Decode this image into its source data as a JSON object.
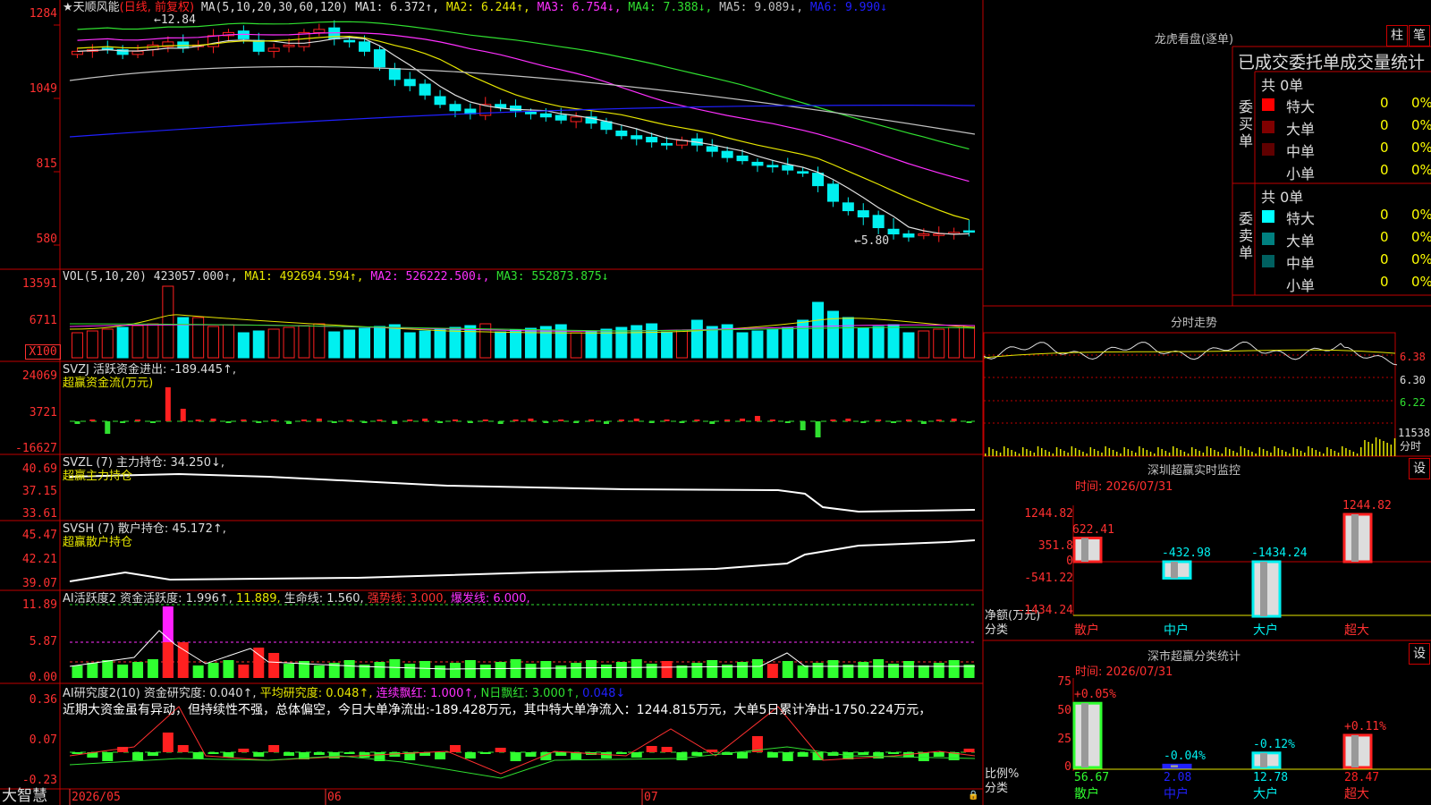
{
  "window": {
    "corner_label": "大智慧"
  },
  "colors": {
    "up": "#ff2020",
    "down": "#00f0f0",
    "bg": "#000000",
    "border": "#c00000",
    "ma1": "#e0e0e0",
    "ma2": "#e6e600",
    "ma3": "#ff30ff",
    "ma4": "#30e030",
    "ma5": "#c0c0c0",
    "ma6": "#2020ff"
  },
  "main": {
    "title_star": "★天顺风能",
    "period": "(日线, 前复权)",
    "ma_label": "MA(5,10,20,30,60,120)",
    "ma1": "MA1: 6.372↑,",
    "ma2": "MA2: 6.244↑,",
    "ma3": "MA3: 6.754↓,",
    "ma4": "MA4: 7.388↓,",
    "ma5": "MA5: 9.089↓,",
    "ma6": "MA6: 9.990↓",
    "axis": [
      "1284",
      "1049",
      "815",
      "580"
    ],
    "high_note": "←12.84",
    "low_note": "←5.80"
  },
  "vol": {
    "label": "VOL(5,10,20)",
    "v": "423057.000↑,",
    "ma1": "MA1: 492694.594↑,",
    "ma2": "MA2: 526222.500↓,",
    "ma3": "MA3: 552873.875↓",
    "axis": [
      "13591",
      "6711"
    ],
    "unit": "X100"
  },
  "svzj": {
    "label": "SVZJ  活跃资金进出: -189.445↑,",
    "sub": "超赢资金流(万元)",
    "axis": [
      "24069",
      "3721",
      "-16627"
    ]
  },
  "svzl": {
    "label": "SVZL (7) 主力持仓: 34.250↓,",
    "sub": "超赢主力持仓",
    "axis": [
      "40.69",
      "37.15",
      "33.61"
    ]
  },
  "svsh": {
    "label": "SVSH (7) 散户持仓: 45.172↑,",
    "sub": "超赢散户持仓",
    "axis": [
      "45.47",
      "42.21",
      "39.07"
    ]
  },
  "ai1": {
    "label": "AI活跃度2 资金活跃度: 1.996↑,",
    "v2": "11.889,",
    "v3": "生命线: 1.560,",
    "v4": "强势线: 3.000,",
    "v5": "爆发线: 6.000,",
    "axis": [
      "11.89",
      "5.87",
      "0.00"
    ]
  },
  "ai2": {
    "label": "AI研究度2(10) 资金研究度: 0.040↑,",
    "v2": "平均研究度: 0.048↑,",
    "v3": "连续飘红: 1.000↑,",
    "v4": "N日飘红: 3.000↑,",
    "v5": "0.048↓",
    "comment": "近期大资金虽有异动，但持续性不强，总体偏空，今日大单净流出:-189.428万元，其中特大单净流入：1244.815万元，大单5日累计净出-1750.224万元，",
    "axis": [
      "0.36",
      "0.07",
      "-0.23"
    ]
  },
  "dates": [
    "2026/05",
    "06",
    "07"
  ],
  "dragon": {
    "title": "龙虎看盘(逐单)",
    "btn1": "柱",
    "btn2": "笔",
    "header": "已成交委托单成交量统计",
    "buy_side": "委买单",
    "sell_side": "委卖单",
    "buy_total": "共 0单",
    "sell_total": "共 0单",
    "buy_rows": [
      {
        "name": "特大",
        "v": "0",
        "p": "0%"
      },
      {
        "name": "大单",
        "v": "0",
        "p": "0%"
      },
      {
        "name": "中单",
        "v": "0",
        "p": "0%"
      },
      {
        "name": "小单",
        "v": "0",
        "p": "0%"
      }
    ],
    "sell_rows": [
      {
        "name": "特大",
        "v": "0",
        "p": "0%"
      },
      {
        "name": "大单",
        "v": "0",
        "p": "0%"
      },
      {
        "name": "中单",
        "v": "0",
        "p": "0%"
      },
      {
        "name": "小单",
        "v": "0",
        "p": "0%"
      }
    ]
  },
  "minute": {
    "title": "分时走势",
    "axis": [
      "6.38",
      "6.30",
      "6.22"
    ],
    "vol_label": "11538",
    "time_label": "分时"
  },
  "monitor": {
    "title": "深圳超赢实时监控",
    "btn": "设",
    "time": "时间: 2026/07/31",
    "axis": [
      "1244.82",
      "351.8",
      "0",
      "-541.22",
      "-1434.24"
    ],
    "ylabel": "净额(万元)",
    "xlabel": "分类",
    "bars": [
      {
        "name": "散户",
        "v": 622.41,
        "label": "622.41"
      },
      {
        "name": "中户",
        "v": -432.98,
        "label": "-432.98"
      },
      {
        "name": "大户",
        "v": -1434.24,
        "label": "-1434.24"
      },
      {
        "name": "超大",
        "v": 1244.82,
        "label": "1244.82"
      }
    ]
  },
  "classify": {
    "title": "深市超赢分类统计",
    "btn": "设",
    "time": "时间: 2026/07/31",
    "axis": [
      "75",
      "50",
      "25",
      "0"
    ],
    "ylabel": "比例%",
    "xlabel": "分类",
    "bars": [
      {
        "name": "散户",
        "v": 56.67,
        "label": "56.67",
        "chg": "+0.05%"
      },
      {
        "name": "中户",
        "v": 2.08,
        "label": "2.08",
        "chg": "-0.04%"
      },
      {
        "name": "大户",
        "v": 12.78,
        "label": "12.78",
        "chg": "-0.12%"
      },
      {
        "name": "超大",
        "v": 28.47,
        "label": "28.47",
        "chg": "+0.11%"
      }
    ]
  }
}
